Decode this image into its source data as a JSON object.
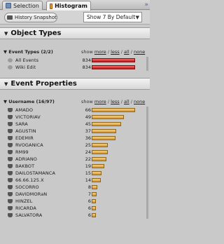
{
  "tabs": [
    {
      "label": "Selection",
      "active": false
    },
    {
      "label": "Histogram",
      "active": true
    }
  ],
  "tab_overflow": "»",
  "toolbar": {
    "snapshot_label": "History Snapshot",
    "show_select": "Show 7 By Default",
    "select_arrow": "▼"
  },
  "object_types": {
    "title": "Object Types",
    "sub_label": "Event Types (2/2)",
    "rows": [
      {
        "label": "All Events",
        "count": "834",
        "fraction": 1.0
      },
      {
        "label": "Wiki Edit",
        "count": "834",
        "fraction": 1.0
      }
    ]
  },
  "event_properties": {
    "title": "Event Properties",
    "sub_label": "Username (16/97)",
    "rows": [
      {
        "label": "AMADO",
        "count": "66",
        "fraction": 1.0
      },
      {
        "label": "VICTORIAV",
        "count": "49",
        "fraction": 0.742
      },
      {
        "label": "SARA",
        "count": "45",
        "fraction": 0.682
      },
      {
        "label": "AGUSTIN",
        "count": "37",
        "fraction": 0.561
      },
      {
        "label": "EDEMIR",
        "count": "36",
        "fraction": 0.545
      },
      {
        "label": "RVOGANICA",
        "count": "25",
        "fraction": 0.379
      },
      {
        "label": "RM99",
        "count": "24",
        "fraction": 0.364
      },
      {
        "label": "ADRIANO",
        "count": "22",
        "fraction": 0.333
      },
      {
        "label": "BAKBOT",
        "count": "19",
        "fraction": 0.288
      },
      {
        "label": "DAILOSTAMANCA",
        "count": "15",
        "fraction": 0.227
      },
      {
        "label": "66.66.125.X",
        "count": "14",
        "fraction": 0.212
      },
      {
        "label": "SOCORRO",
        "count": "8",
        "fraction": 0.121
      },
      {
        "label": "DAVIDMORaN",
        "count": "7",
        "fraction": 0.106
      },
      {
        "label": "HINZEL",
        "count": "6",
        "fraction": 0.091
      },
      {
        "label": "RICARDA",
        "count": "6",
        "fraction": 0.091
      },
      {
        "label": "SALVATORA",
        "count": "6",
        "fraction": 0.091
      }
    ]
  },
  "show_links": {
    "prefix": "show",
    "more": "more",
    "less": "less",
    "all": "all",
    "none": "none",
    "sep": "/"
  },
  "colors": {
    "object_bar": "#d42424",
    "event_bar": "#e0a94a"
  }
}
